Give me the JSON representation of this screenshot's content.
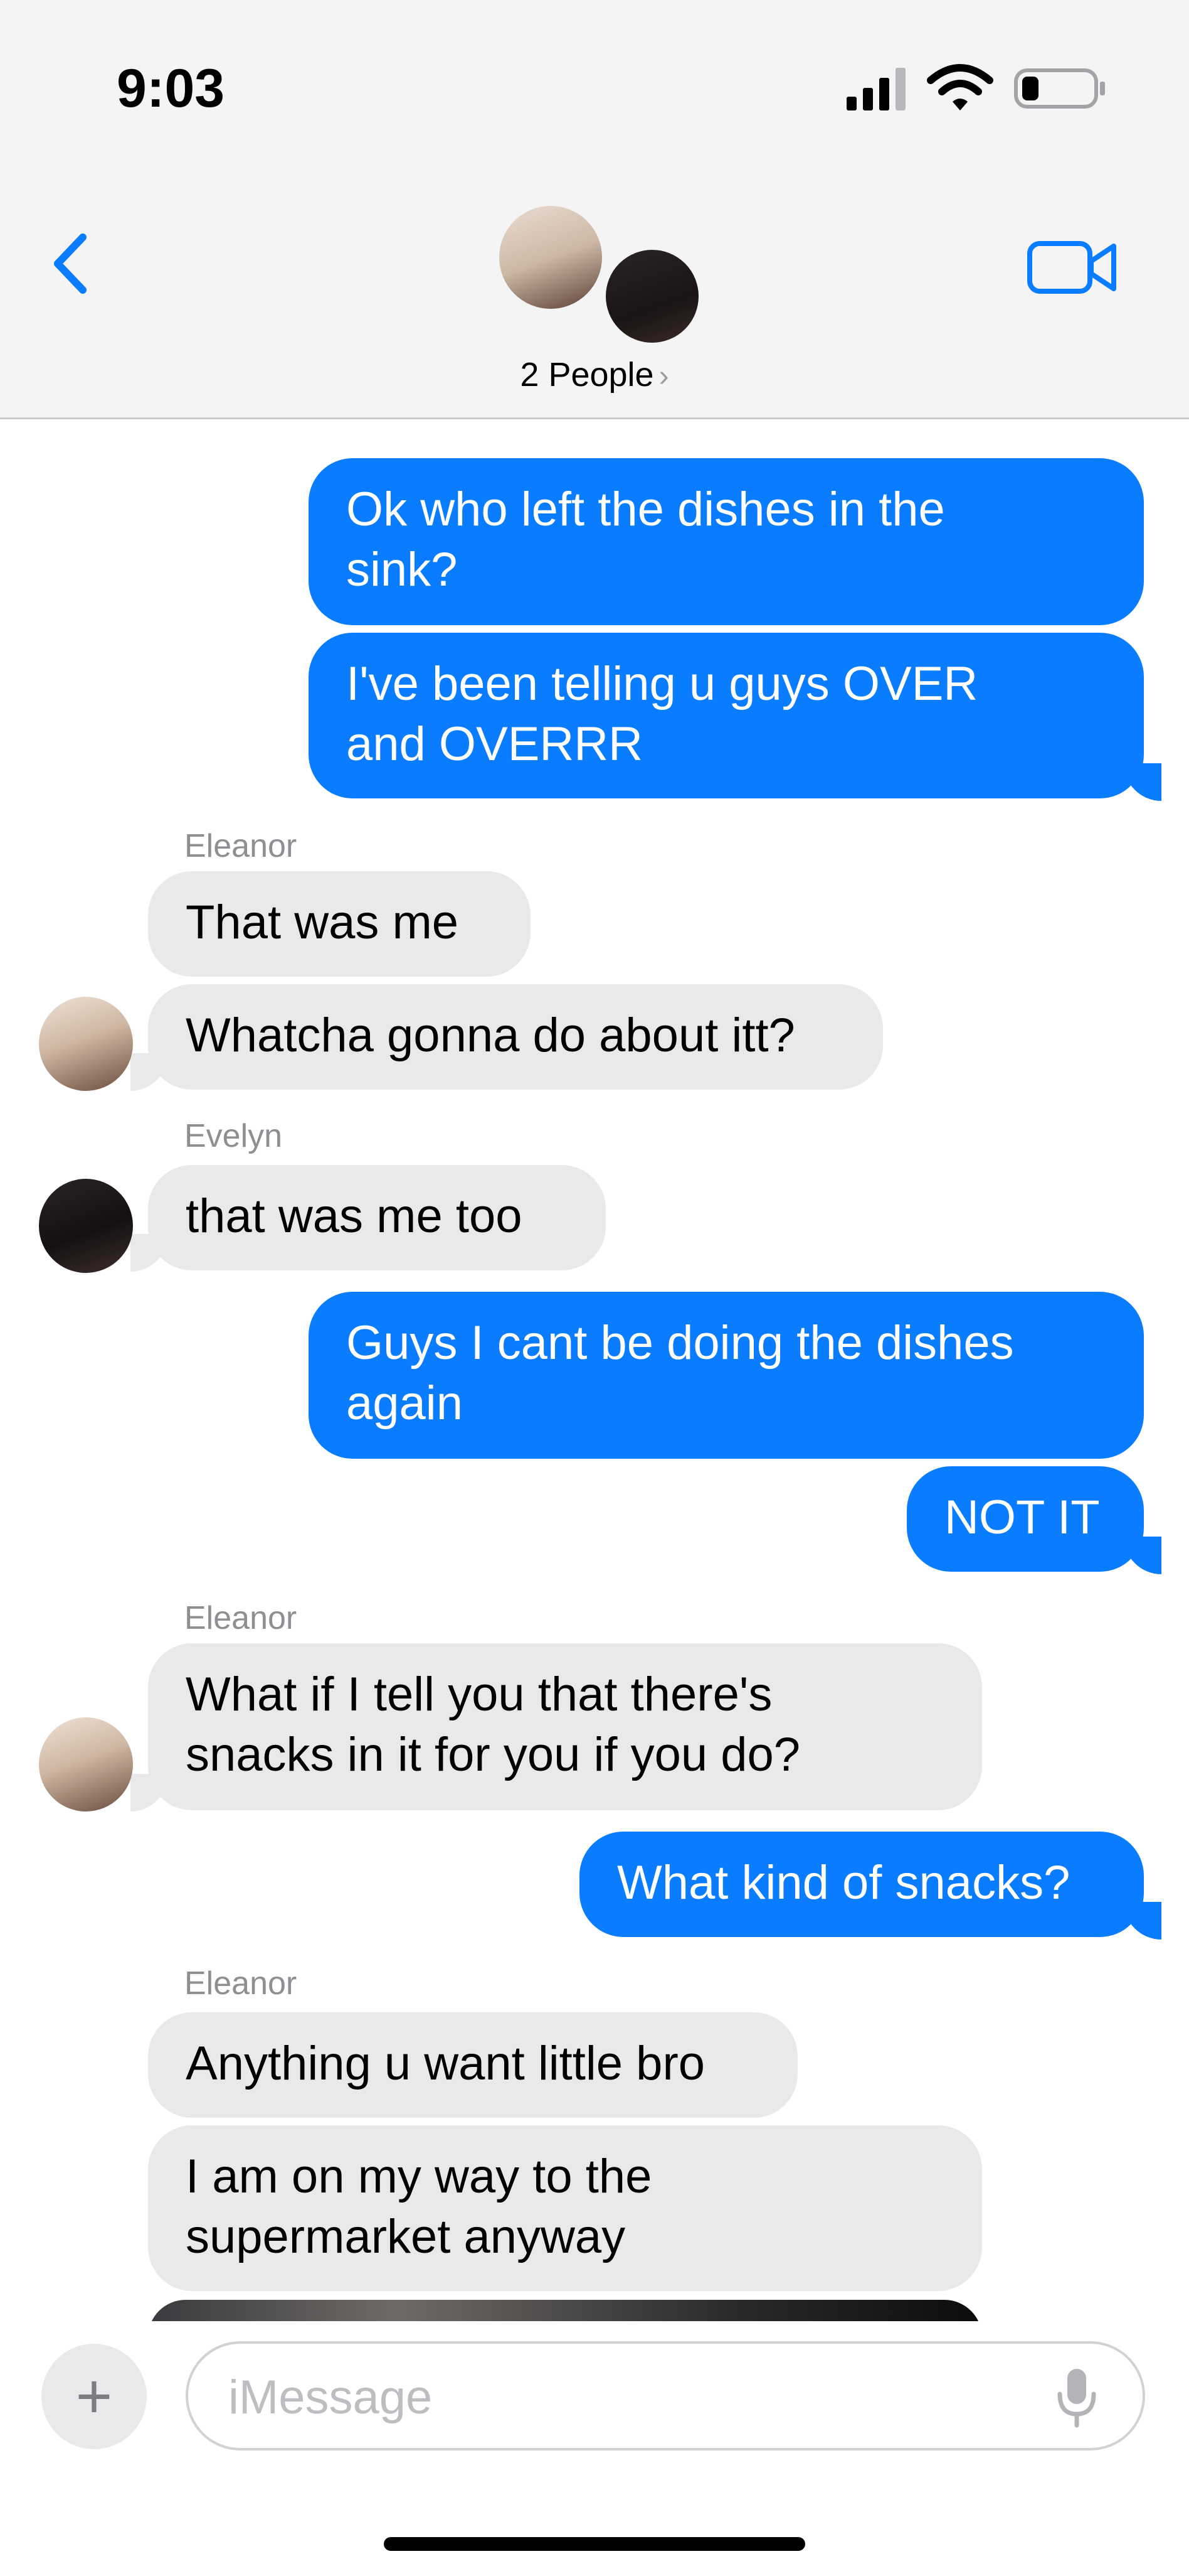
{
  "status_bar": {
    "time": "9:03",
    "icons": [
      "cellular-signal-icon",
      "wifi-icon",
      "battery-icon"
    ],
    "battery_level": 0.2
  },
  "header": {
    "people_label": "2 People",
    "chevron": "›",
    "back_icon": "chevron-left-icon",
    "video_icon": "video-camera-icon"
  },
  "messages": [
    {
      "id": "m1",
      "direction": "sent",
      "text": "Ok who left the dishes in the\nsink?"
    },
    {
      "id": "m2",
      "direction": "sent",
      "text": "I've been telling u guys OVER\nand OVERRR"
    },
    {
      "id": "m3",
      "direction": "received",
      "sender": "Eleanor",
      "text": "That was me"
    },
    {
      "id": "m4",
      "direction": "received",
      "sender": "Eleanor",
      "text": "Whatcha gonna do about itt?"
    },
    {
      "id": "m5",
      "direction": "received",
      "sender": "Evelyn",
      "text": "that was me too"
    },
    {
      "id": "m6",
      "direction": "sent",
      "text": "Guys I cant be doing the dishes\nagain"
    },
    {
      "id": "m7",
      "direction": "sent",
      "text": "NOT IT"
    },
    {
      "id": "m8",
      "direction": "received",
      "sender": "Eleanor",
      "text": "What if I tell you that there's\nsnacks in it for you if you do?"
    },
    {
      "id": "m9",
      "direction": "sent",
      "text": "What kind of snacks?"
    },
    {
      "id": "m10",
      "direction": "received",
      "sender": "Eleanor",
      "text": "Anything u want little bro"
    },
    {
      "id": "m11",
      "direction": "received",
      "sender": "Eleanor",
      "text": "I am on my way to the\nsupermarket anyway"
    }
  ],
  "sender_labels": {
    "eleanor_1": "Eleanor",
    "evelyn_1": "Evelyn",
    "eleanor_2": "Eleanor",
    "eleanor_3": "Eleanor"
  },
  "input_bar": {
    "placeholder": "iMessage",
    "plus_label": "+",
    "mic_icon": "microphone-icon"
  },
  "colors": {
    "sent_bubble": "#0a7cff",
    "received_bubble": "#e9e9eb",
    "accent": "#0a7cff",
    "header_bg": "#f4f4f5"
  }
}
